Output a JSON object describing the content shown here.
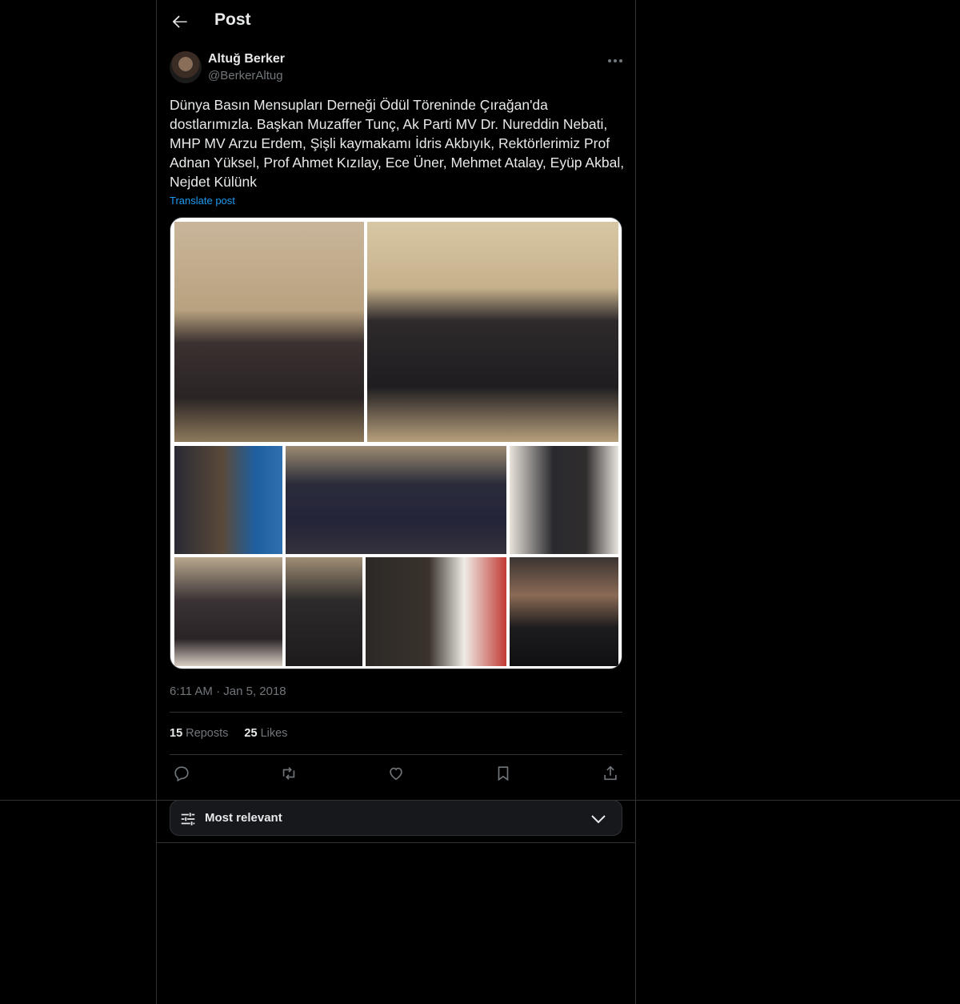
{
  "header": {
    "title": "Post"
  },
  "author": {
    "name": "Altuğ Berker",
    "handle": "@BerkerAltug"
  },
  "post": {
    "text": "Dünya Basın Mensupları Derneği Ödül Töreninde Çırağan'da\ndostlarımızla. Başkan Muzaffer Tunç, Ak Parti MV Dr. Nureddin Nebati,\nMHP MV Arzu Erdem, Şişli kaymakamı İdris Akbıyık, Rektörlerimiz Prof\nAdnan Yüksel, Prof Ahmet Kızılay, Ece Üner, Mehmet Atalay, Eyüp Akbal,\nNejdet Külünk",
    "translate": "Translate post",
    "time": "6:11 AM · Jan 5, 2018"
  },
  "stats": {
    "reposts_count": "15",
    "reposts_label": "Reposts",
    "likes_count": "25",
    "likes_label": "Likes"
  },
  "sort": {
    "label": "Most relevant"
  },
  "icons": {
    "back": "arrow-left-icon",
    "more": "more-icon",
    "reply": "reply-icon",
    "repost": "repost-icon",
    "like": "heart-icon",
    "bookmark": "bookmark-icon",
    "share": "share-icon",
    "sort": "sliders-icon",
    "dropdown": "chevron-down-icon"
  }
}
